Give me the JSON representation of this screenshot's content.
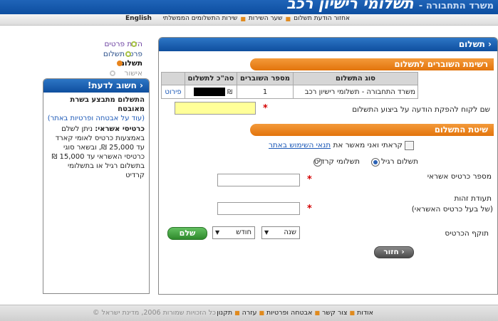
{
  "banner": {
    "title": "תשלומי רישיון רכב",
    "prefix": "משרד התחבורה -"
  },
  "topnav": {
    "items": [
      "אחזור הודעת תשלום",
      "שער השירות",
      "שירות התשלומים הממשלתי"
    ],
    "english": "English"
  },
  "main": {
    "header": "תשלום",
    "section1": "רשימת השוברים לתשלום",
    "table": {
      "headers": [
        "סוג התשלום",
        "מספר השוברים",
        "סה\"כ לתשלום",
        ""
      ],
      "rows": [
        {
          "type": "משרד התחבורה - תשלומי רישיון רכב",
          "count": "1",
          "currency": "₪",
          "details": "פירוט"
        }
      ]
    },
    "notice_label": "שם לקוח להפקת הודעה על ביצוע התשלום",
    "section2": "שיטת התשלום",
    "terms_prefix": "קראתי ואני מאשר את",
    "terms_link": "תנאי השימוש באתר",
    "radio_regular": "תשלום רגיל",
    "radio_credit": "תשלומי קרדיט",
    "card_number_label": "מספר כרטיס אשראי",
    "id_label_1": "תעודת זהות",
    "id_label_2": "(של בעל כרטיס האשראי)",
    "expiry_label": "תוקף הכרטיס",
    "month_placeholder": "חודש",
    "year_placeholder": "שנה",
    "pay_button": "שלם",
    "back_button": "חזור"
  },
  "steps": [
    "הזנת פרטים",
    "פרטי תשלום",
    "תשלום",
    "אישור"
  ],
  "side": {
    "header": "חשוב לדעת!",
    "p1_title": "התשלום מתבצע בשרת מאובטח",
    "p1_link": "(עוד על אבטחה ופרטיות באתר)",
    "p2_bold": "כרטיסי אשראי:",
    "p2_text": "ניתן לשלם באמצעות כרטיס לאומי קארד עד 25,000 ₪, ובשאר סוגי כרטיסי האשראי עד 15,000 ₪ בתשלום רגיל או בתשלומי קרדיט"
  },
  "footer": {
    "links": [
      "אודות",
      "צור קשר",
      "אבטחה ופרטיות",
      "עזרה",
      "תקנון"
    ],
    "copyright": "כל הזכויות שמורות 2006, מדינת ישראל ©"
  }
}
